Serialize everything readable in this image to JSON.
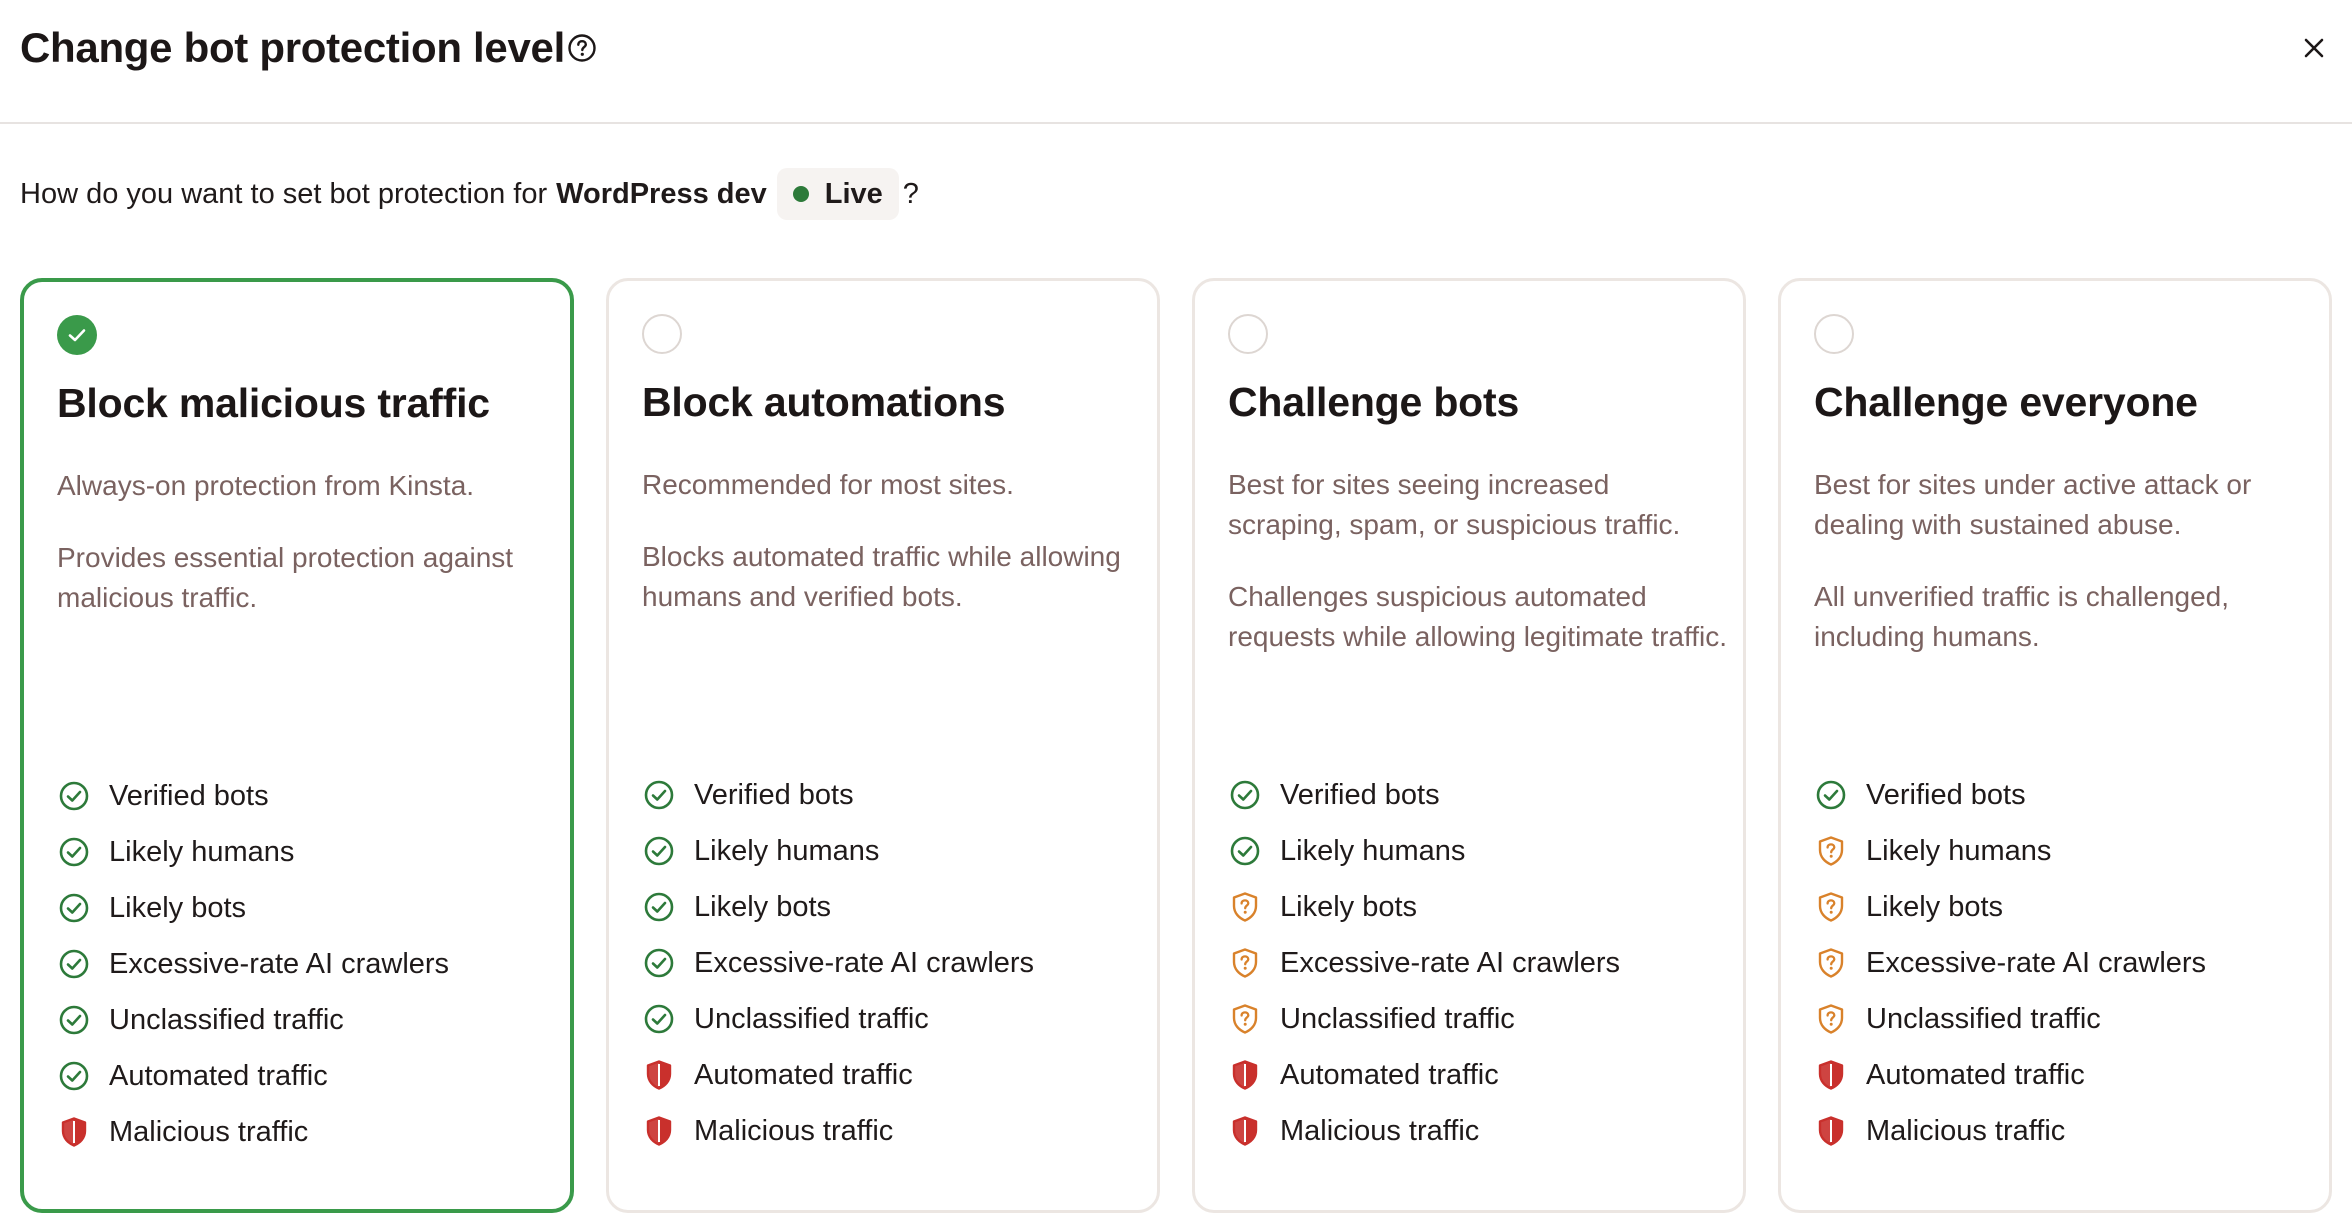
{
  "dialog": {
    "title": "Change bot protection level",
    "help_icon": "question-circle-icon",
    "close_icon": "close-icon"
  },
  "question": {
    "prefix": "How do you want to set bot protection for",
    "site_name": "WordPress dev",
    "environment": "Live",
    "environment_color": "#2d7a3a",
    "suffix": "?"
  },
  "status_colors": {
    "allowed": "#2d7a3a",
    "challenged": "#d9822b",
    "blocked": "#c9302c",
    "selected_accent": "#3a9a4a"
  },
  "options": [
    {
      "title": "Block malicious traffic",
      "selected": true,
      "desc1": "Always-on protection from Kinsta.",
      "desc2": "Provides essential protection against malicious traffic.",
      "features": [
        {
          "label": "Verified bots",
          "status": "allowed"
        },
        {
          "label": "Likely humans",
          "status": "allowed"
        },
        {
          "label": "Likely bots",
          "status": "allowed"
        },
        {
          "label": "Excessive-rate AI crawlers",
          "status": "allowed"
        },
        {
          "label": "Unclassified traffic",
          "status": "allowed"
        },
        {
          "label": "Automated traffic",
          "status": "allowed"
        },
        {
          "label": "Malicious traffic",
          "status": "blocked"
        }
      ]
    },
    {
      "title": "Block automations",
      "selected": false,
      "desc1": "Recommended for most sites.",
      "desc2": "Blocks automated traffic while allowing humans and verified bots.",
      "features": [
        {
          "label": "Verified bots",
          "status": "allowed"
        },
        {
          "label": "Likely humans",
          "status": "allowed"
        },
        {
          "label": "Likely bots",
          "status": "allowed"
        },
        {
          "label": "Excessive-rate AI crawlers",
          "status": "allowed"
        },
        {
          "label": "Unclassified traffic",
          "status": "allowed"
        },
        {
          "label": "Automated traffic",
          "status": "blocked"
        },
        {
          "label": "Malicious traffic",
          "status": "blocked"
        }
      ]
    },
    {
      "title": "Challenge bots",
      "selected": false,
      "desc1": "Best for sites seeing increased scraping, spam, or suspicious traffic.",
      "desc2": "Challenges suspicious automated requests while allowing legitimate traffic.",
      "features": [
        {
          "label": "Verified bots",
          "status": "allowed"
        },
        {
          "label": "Likely humans",
          "status": "allowed"
        },
        {
          "label": "Likely bots",
          "status": "challenged"
        },
        {
          "label": "Excessive-rate AI crawlers",
          "status": "challenged"
        },
        {
          "label": "Unclassified traffic",
          "status": "challenged"
        },
        {
          "label": "Automated traffic",
          "status": "blocked"
        },
        {
          "label": "Malicious traffic",
          "status": "blocked"
        }
      ]
    },
    {
      "title": "Challenge everyone",
      "selected": false,
      "desc1": "Best for sites under active attack or dealing with sustained abuse.",
      "desc2": "All unverified traffic is challenged, including humans.",
      "features": [
        {
          "label": "Verified bots",
          "status": "allowed"
        },
        {
          "label": "Likely humans",
          "status": "challenged"
        },
        {
          "label": "Likely bots",
          "status": "challenged"
        },
        {
          "label": "Excessive-rate AI crawlers",
          "status": "challenged"
        },
        {
          "label": "Unclassified traffic",
          "status": "challenged"
        },
        {
          "label": "Automated traffic",
          "status": "blocked"
        },
        {
          "label": "Malicious traffic",
          "status": "blocked"
        }
      ]
    }
  ],
  "icons": {
    "allowed": "check-circle-icon",
    "challenged": "question-shield-icon",
    "blocked": "shield-icon",
    "selected_radio": "check-icon"
  }
}
